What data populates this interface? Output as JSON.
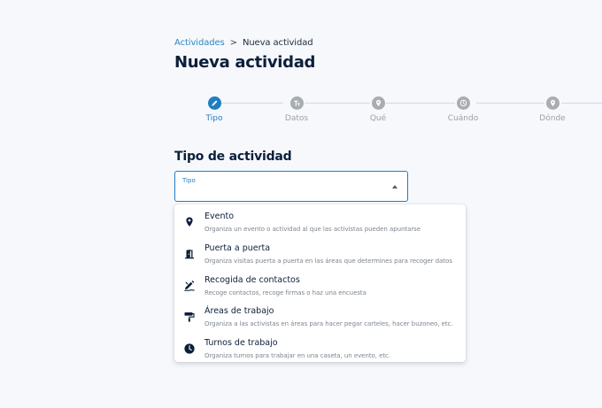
{
  "breadcrumb": {
    "parent": "Actividades",
    "separator": ">",
    "current": "Nueva actividad"
  },
  "page_title": "Nueva actividad",
  "stepper": {
    "steps": [
      {
        "label": "Tipo",
        "icon": "pencil-icon",
        "active": true
      },
      {
        "label": "Datos",
        "icon": "text-format-icon",
        "active": false
      },
      {
        "label": "Qué",
        "icon": "location-pin-icon",
        "active": false
      },
      {
        "label": "Cuándo",
        "icon": "clock-icon",
        "active": false
      },
      {
        "label": "Dónde",
        "icon": "location-pin-icon",
        "active": false
      }
    ]
  },
  "section_title": "Tipo de actividad",
  "select": {
    "label": "Tipo",
    "value": ""
  },
  "options": [
    {
      "title": "Evento",
      "desc": "Organiza un evento o actividad al que las activistas pueden apuntarse",
      "icon": "location-pin-icon"
    },
    {
      "title": "Puerta a puerta",
      "desc": "Organiza visitas puerta a puerta en las áreas que determines para recoger datos",
      "icon": "door-icon"
    },
    {
      "title": "Recogida de contactos",
      "desc": "Recoge contactos, recoge firmas o haz una encuesta",
      "icon": "sign-form-icon"
    },
    {
      "title": "Áreas de trabajo",
      "desc": "Organiza a las activistas en áreas para hacer pegar carteles, hacer buzoneo, etc.",
      "icon": "paint-roller-icon"
    },
    {
      "title": "Turnos de trabajo",
      "desc": "Organiza turnos para trabajar en una caseta, un evento, etc.",
      "icon": "clock-icon"
    }
  ],
  "colors": {
    "accent": "#1f7ec2",
    "heading": "#0b1f3a",
    "muted": "#9aa0a8",
    "inactive_step": "#a9acb1",
    "background": "#f6f8fc"
  }
}
